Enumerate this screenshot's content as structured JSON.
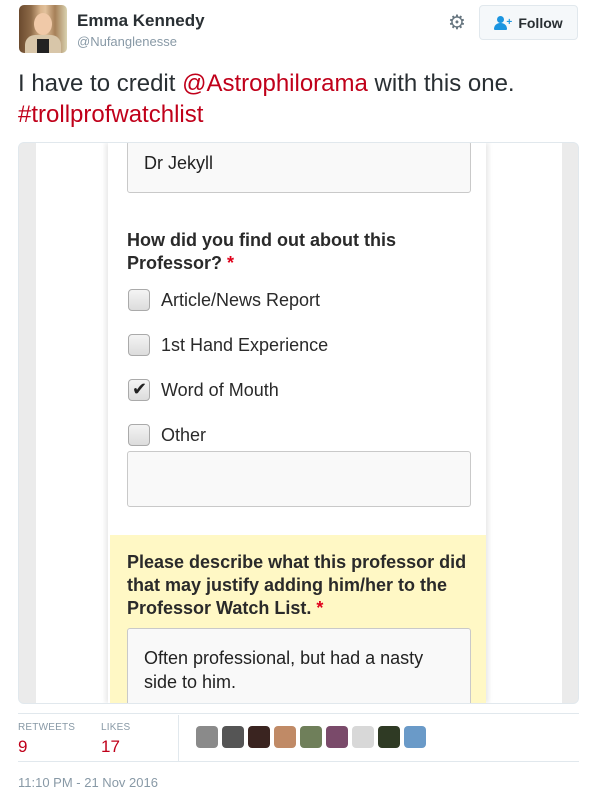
{
  "author": {
    "name": "Emma Kennedy",
    "handle": "@Nufanglenesse",
    "avatar_icon": "profile-photo"
  },
  "header": {
    "gear_icon": "gear-icon",
    "gear_glyph": "⚙",
    "follow_label": "Follow",
    "follow_icon": "add-user-icon",
    "accent_color": "#1b95e0"
  },
  "tweet": {
    "text_before": "I have to credit ",
    "mention": "@Astrophilorama",
    "text_after": " with this one.",
    "hashtag": "#trollprofwatchlist",
    "link_color": "#c0001a"
  },
  "media": {
    "name_field_value": "Dr Jekyll",
    "question1": "How did you find out about this Professor?",
    "required_marker": "*",
    "options": [
      {
        "label": "Article/News Report",
        "checked": false
      },
      {
        "label": "1st Hand Experience",
        "checked": false
      },
      {
        "label": "Word of Mouth",
        "checked": true
      },
      {
        "label": "Other",
        "checked": false
      }
    ],
    "check_glyph": "✔",
    "other_field_value": "",
    "question2": "Please describe what this professor did that may justify adding him/her to the Professor Watch List.",
    "description_value": "Often professional, but had a nasty side to him.",
    "highlight_color": "#fff8c5"
  },
  "stats": {
    "retweets_label": "RETWEETS",
    "retweets_count": "9",
    "likes_label": "LIKES",
    "likes_count": "17",
    "liker_avatars": [
      {
        "desc": "grayscale landscape",
        "color": "#8a8a8a"
      },
      {
        "desc": "black and white portrait",
        "color": "#555555"
      },
      {
        "desc": "dark haired person",
        "color": "#3a2420"
      },
      {
        "desc": "bald man",
        "color": "#c08a66"
      },
      {
        "desc": "man outdoors in plaid",
        "color": "#6f7f5a"
      },
      {
        "desc": "man with sunglasses",
        "color": "#7a4a6a"
      },
      {
        "desc": "sketched portrait",
        "color": "#d8d8d8"
      },
      {
        "desc": "person in dark setting",
        "color": "#2f3a24"
      },
      {
        "desc": "blue cartoon character",
        "color": "#6a9ac8"
      }
    ]
  },
  "timestamp": "11:10 PM - 21 Nov 2016"
}
